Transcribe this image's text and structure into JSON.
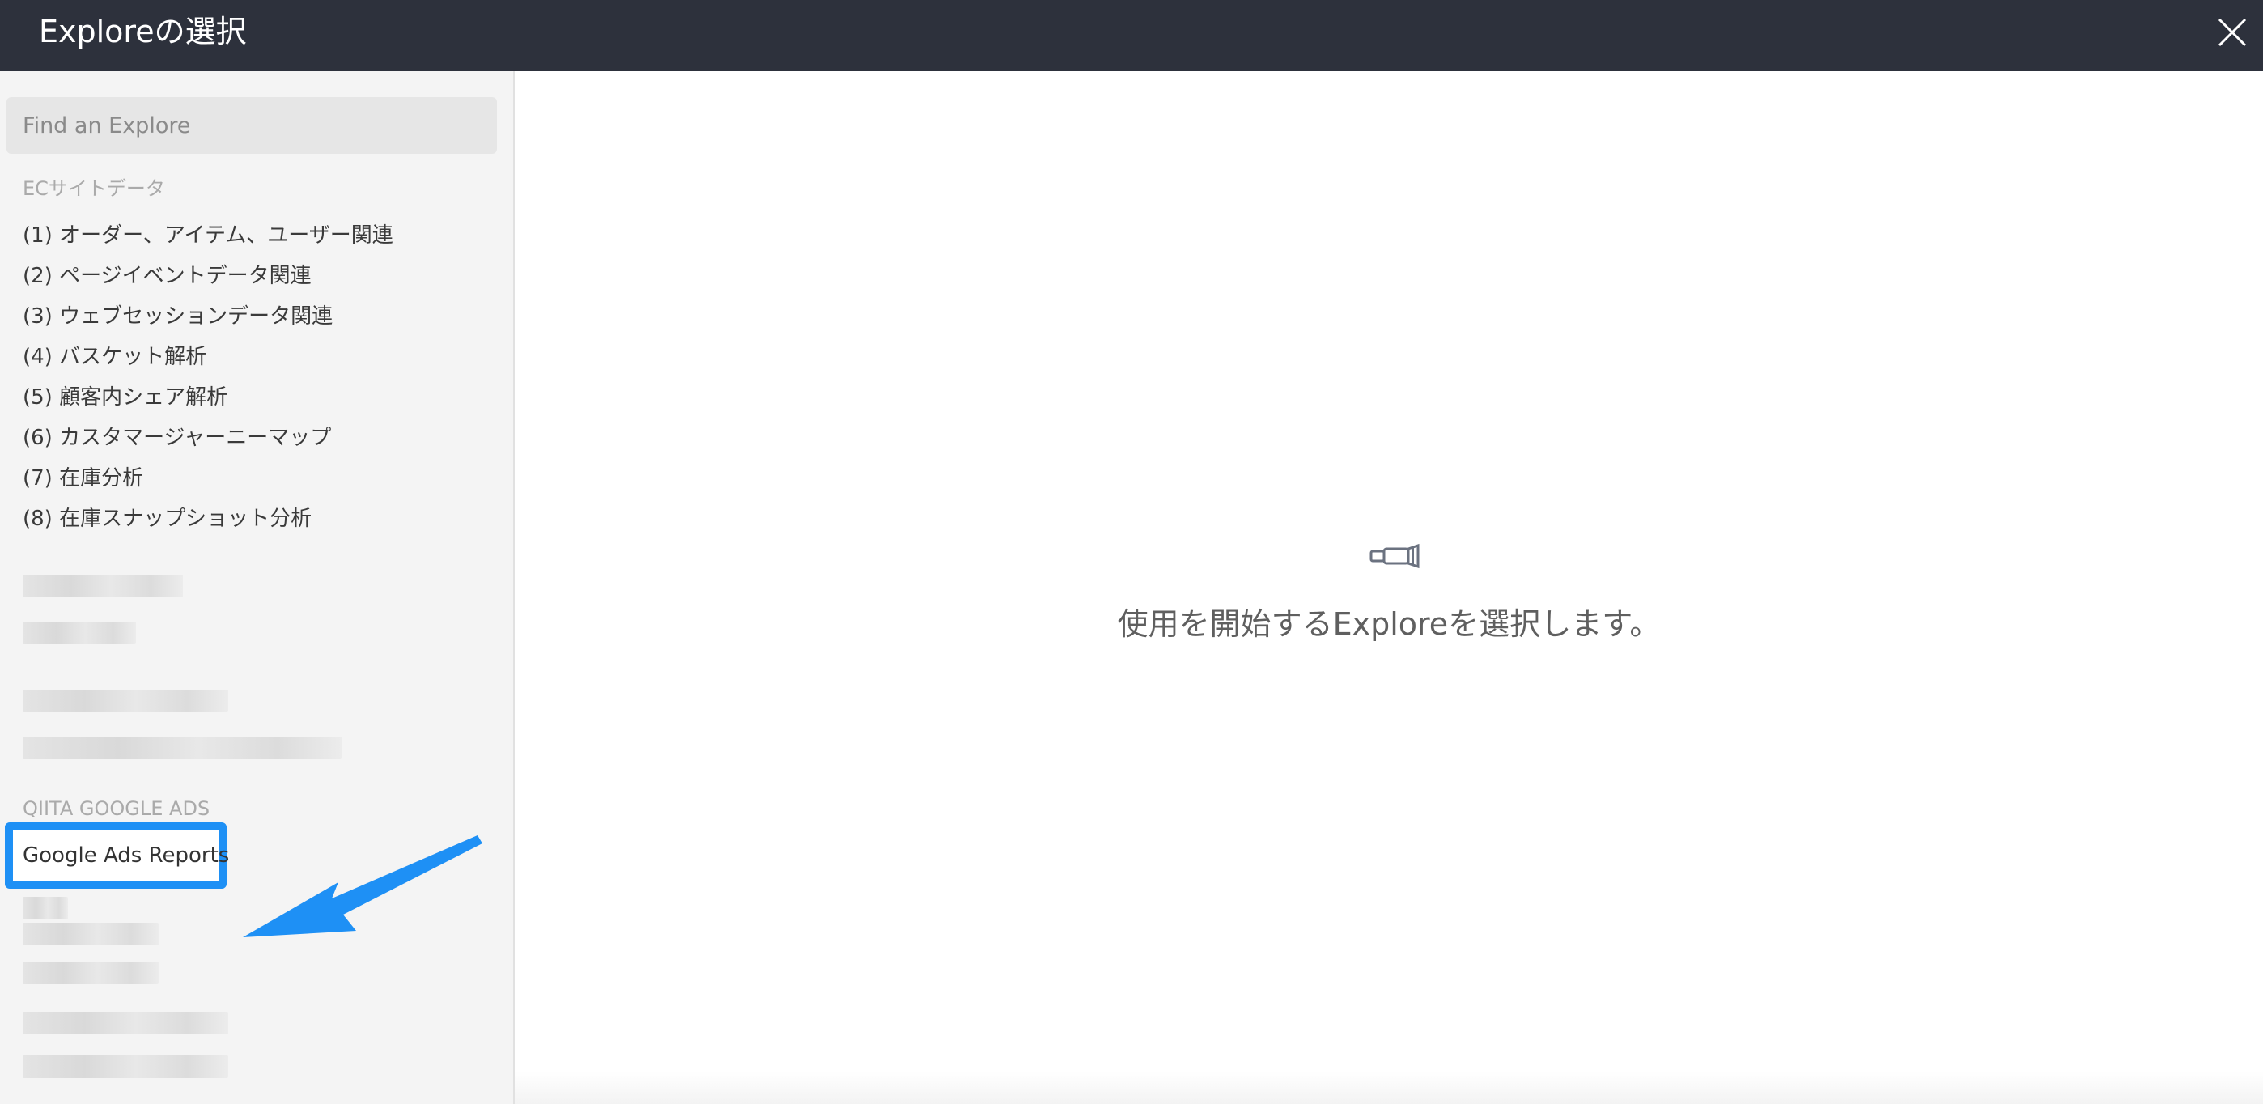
{
  "header": {
    "title": "Exploreの選択",
    "close_icon": "close-icon"
  },
  "sidebar": {
    "search": {
      "placeholder": "Find an Explore",
      "value": ""
    },
    "groups": [
      {
        "title": "ECサイトデータ",
        "items": [
          {
            "label": "(1) オーダー、アイテム、ユーザー関連"
          },
          {
            "label": "(2) ページイベントデータ関連"
          },
          {
            "label": "(3) ウェブセッションデータ関連"
          },
          {
            "label": "(4) バスケット解析"
          },
          {
            "label": "(5) 顧客内シェア解析"
          },
          {
            "label": "(6) カスタマージャーニーマップ"
          },
          {
            "label": "(7) 在庫分析"
          },
          {
            "label": "(8) 在庫スナップショット分析"
          }
        ]
      },
      {
        "title": "QIITA GOOGLE ADS",
        "items": [
          {
            "label": "Google Ads Reports",
            "highlighted": true
          }
        ]
      }
    ],
    "annotation": {
      "highlight_color": "#1e90f5",
      "arrow_icon": "arrow-icon"
    }
  },
  "main": {
    "empty_state": {
      "icon": "explore-icon",
      "message": "使用を開始するExploreを選択します。"
    }
  },
  "colors": {
    "header_bg": "#2d313c",
    "sidebar_bg": "#f4f4f4",
    "accent": "#1e90f5"
  }
}
